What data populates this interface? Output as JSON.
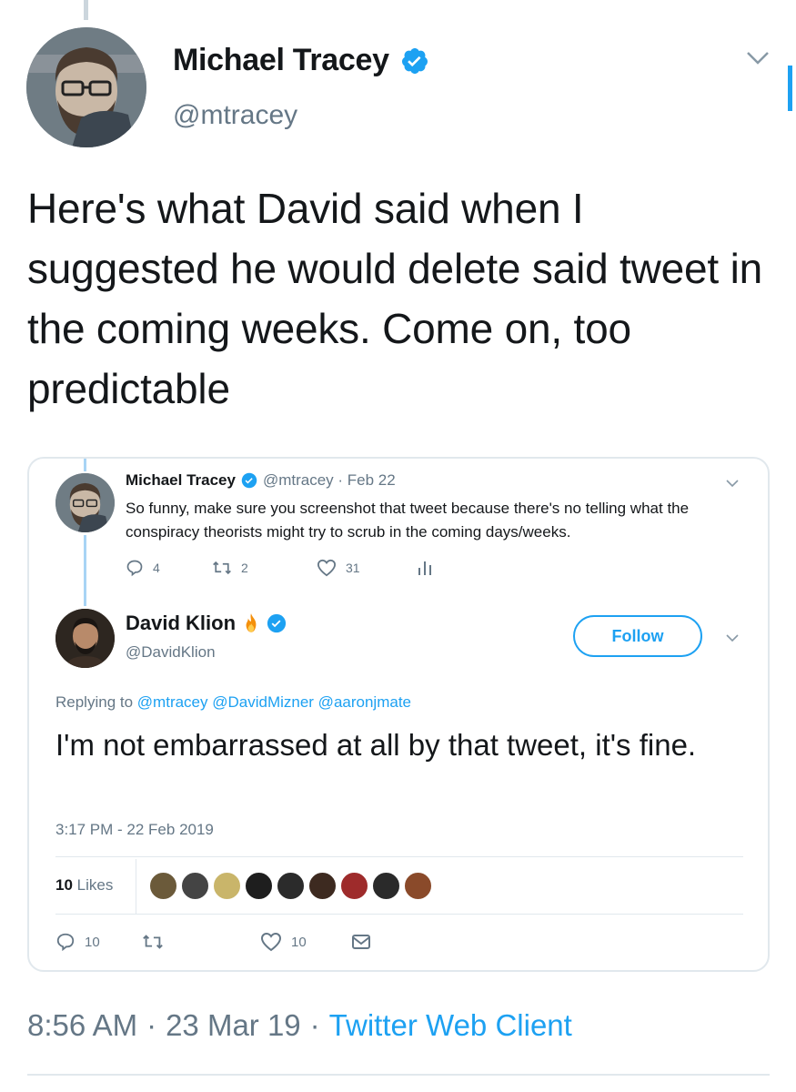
{
  "main_tweet": {
    "author_name": "Michael Tracey",
    "author_handle": "@mtracey",
    "text": "Here's what David said when I suggested he would delete said tweet in the coming weeks. Come on, too predictable",
    "time": "8:56 AM",
    "date": "23 Mar 19",
    "separator": "·",
    "client": "Twitter Web Client",
    "verified_color": "#1da1f2"
  },
  "embedded": {
    "parent_tweet": {
      "author_name": "Michael Tracey",
      "meta": "@mtracey · Feb 22",
      "text": "So funny, make sure you screenshot that tweet because there's no telling what the conspiracy theorists might try to scrub in the coming days/weeks.",
      "replies": "4",
      "retweets": "2",
      "likes": "31"
    },
    "reply_tweet": {
      "author_name": "David Klion",
      "author_handle": "@DavidKlion",
      "follow_label": "Follow",
      "replying_prefix": "Replying to",
      "replying_mentions": "@mtracey @DavidMizner @aaronjmate",
      "text": "I'm not embarrassed at all by that tweet, it's fine.",
      "timestamp": "3:17 PM - 22 Feb 2019",
      "likes_count": "10",
      "likes_word": "Likes",
      "replies": "10",
      "likes": "10",
      "liker_colors": [
        "#6b5a3a",
        "#444444",
        "#c9b56a",
        "#1e1e1e",
        "#2b2b2b",
        "#3d2a20",
        "#9e2b2b",
        "#2a2a2a",
        "#8a4a2a"
      ]
    }
  },
  "icons": [
    "verified-icon",
    "chevron-down-icon",
    "reply-icon",
    "retweet-icon",
    "like-icon",
    "analytics-icon",
    "message-icon",
    "fire-emoji"
  ]
}
